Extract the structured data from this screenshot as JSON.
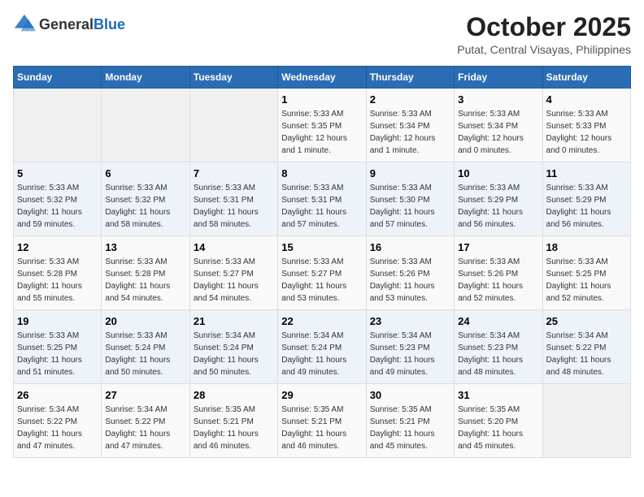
{
  "logo": {
    "text_general": "General",
    "text_blue": "Blue"
  },
  "title": "October 2025",
  "location": "Putat, Central Visayas, Philippines",
  "days_of_week": [
    "Sunday",
    "Monday",
    "Tuesday",
    "Wednesday",
    "Thursday",
    "Friday",
    "Saturday"
  ],
  "weeks": [
    [
      {
        "day": "",
        "info": ""
      },
      {
        "day": "",
        "info": ""
      },
      {
        "day": "",
        "info": ""
      },
      {
        "day": "1",
        "info": "Sunrise: 5:33 AM\nSunset: 5:35 PM\nDaylight: 12 hours\nand 1 minute."
      },
      {
        "day": "2",
        "info": "Sunrise: 5:33 AM\nSunset: 5:34 PM\nDaylight: 12 hours\nand 1 minute."
      },
      {
        "day": "3",
        "info": "Sunrise: 5:33 AM\nSunset: 5:34 PM\nDaylight: 12 hours\nand 0 minutes."
      },
      {
        "day": "4",
        "info": "Sunrise: 5:33 AM\nSunset: 5:33 PM\nDaylight: 12 hours\nand 0 minutes."
      }
    ],
    [
      {
        "day": "5",
        "info": "Sunrise: 5:33 AM\nSunset: 5:32 PM\nDaylight: 11 hours\nand 59 minutes."
      },
      {
        "day": "6",
        "info": "Sunrise: 5:33 AM\nSunset: 5:32 PM\nDaylight: 11 hours\nand 58 minutes."
      },
      {
        "day": "7",
        "info": "Sunrise: 5:33 AM\nSunset: 5:31 PM\nDaylight: 11 hours\nand 58 minutes."
      },
      {
        "day": "8",
        "info": "Sunrise: 5:33 AM\nSunset: 5:31 PM\nDaylight: 11 hours\nand 57 minutes."
      },
      {
        "day": "9",
        "info": "Sunrise: 5:33 AM\nSunset: 5:30 PM\nDaylight: 11 hours\nand 57 minutes."
      },
      {
        "day": "10",
        "info": "Sunrise: 5:33 AM\nSunset: 5:29 PM\nDaylight: 11 hours\nand 56 minutes."
      },
      {
        "day": "11",
        "info": "Sunrise: 5:33 AM\nSunset: 5:29 PM\nDaylight: 11 hours\nand 56 minutes."
      }
    ],
    [
      {
        "day": "12",
        "info": "Sunrise: 5:33 AM\nSunset: 5:28 PM\nDaylight: 11 hours\nand 55 minutes."
      },
      {
        "day": "13",
        "info": "Sunrise: 5:33 AM\nSunset: 5:28 PM\nDaylight: 11 hours\nand 54 minutes."
      },
      {
        "day": "14",
        "info": "Sunrise: 5:33 AM\nSunset: 5:27 PM\nDaylight: 11 hours\nand 54 minutes."
      },
      {
        "day": "15",
        "info": "Sunrise: 5:33 AM\nSunset: 5:27 PM\nDaylight: 11 hours\nand 53 minutes."
      },
      {
        "day": "16",
        "info": "Sunrise: 5:33 AM\nSunset: 5:26 PM\nDaylight: 11 hours\nand 53 minutes."
      },
      {
        "day": "17",
        "info": "Sunrise: 5:33 AM\nSunset: 5:26 PM\nDaylight: 11 hours\nand 52 minutes."
      },
      {
        "day": "18",
        "info": "Sunrise: 5:33 AM\nSunset: 5:25 PM\nDaylight: 11 hours\nand 52 minutes."
      }
    ],
    [
      {
        "day": "19",
        "info": "Sunrise: 5:33 AM\nSunset: 5:25 PM\nDaylight: 11 hours\nand 51 minutes."
      },
      {
        "day": "20",
        "info": "Sunrise: 5:33 AM\nSunset: 5:24 PM\nDaylight: 11 hours\nand 50 minutes."
      },
      {
        "day": "21",
        "info": "Sunrise: 5:34 AM\nSunset: 5:24 PM\nDaylight: 11 hours\nand 50 minutes."
      },
      {
        "day": "22",
        "info": "Sunrise: 5:34 AM\nSunset: 5:24 PM\nDaylight: 11 hours\nand 49 minutes."
      },
      {
        "day": "23",
        "info": "Sunrise: 5:34 AM\nSunset: 5:23 PM\nDaylight: 11 hours\nand 49 minutes."
      },
      {
        "day": "24",
        "info": "Sunrise: 5:34 AM\nSunset: 5:23 PM\nDaylight: 11 hours\nand 48 minutes."
      },
      {
        "day": "25",
        "info": "Sunrise: 5:34 AM\nSunset: 5:22 PM\nDaylight: 11 hours\nand 48 minutes."
      }
    ],
    [
      {
        "day": "26",
        "info": "Sunrise: 5:34 AM\nSunset: 5:22 PM\nDaylight: 11 hours\nand 47 minutes."
      },
      {
        "day": "27",
        "info": "Sunrise: 5:34 AM\nSunset: 5:22 PM\nDaylight: 11 hours\nand 47 minutes."
      },
      {
        "day": "28",
        "info": "Sunrise: 5:35 AM\nSunset: 5:21 PM\nDaylight: 11 hours\nand 46 minutes."
      },
      {
        "day": "29",
        "info": "Sunrise: 5:35 AM\nSunset: 5:21 PM\nDaylight: 11 hours\nand 46 minutes."
      },
      {
        "day": "30",
        "info": "Sunrise: 5:35 AM\nSunset: 5:21 PM\nDaylight: 11 hours\nand 45 minutes."
      },
      {
        "day": "31",
        "info": "Sunrise: 5:35 AM\nSunset: 5:20 PM\nDaylight: 11 hours\nand 45 minutes."
      },
      {
        "day": "",
        "info": ""
      }
    ]
  ]
}
